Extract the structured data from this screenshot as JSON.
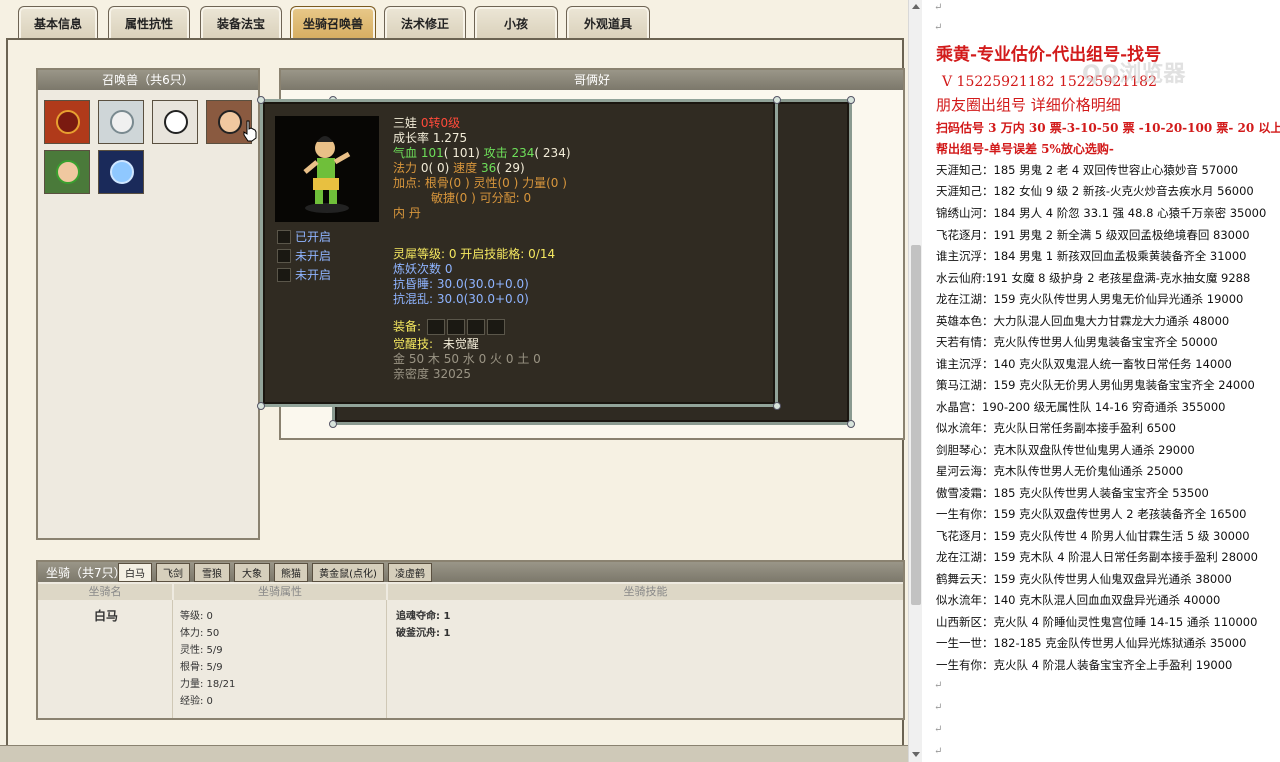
{
  "tabs": [
    {
      "label": "基本信息"
    },
    {
      "label": "属性抗性"
    },
    {
      "label": "装备法宝"
    },
    {
      "label": "坐骑召唤兽"
    },
    {
      "label": "法术修正"
    },
    {
      "label": "小孩"
    },
    {
      "label": "外观道具"
    }
  ],
  "summon_panel": {
    "title": "召唤兽（共6只）"
  },
  "detail_panel": {
    "title": "哥俩好"
  },
  "tooltip": {
    "name": "三娃",
    "rebirth": "0转0级",
    "growth": "成长率 1.275",
    "hp_label": "气血",
    "hp_value": "101",
    "hp_max": "( 101)",
    "atk_label": "攻击",
    "atk_value": "234",
    "atk_max": "( 234)",
    "mp_label": "法力",
    "mp_value": "0",
    "mp_max": "( 0)",
    "spd_label": "速度",
    "spd_value": "36",
    "spd_max": "( 29)",
    "points_line1": "加点:  根骨(0 ) 灵性(0 ) 力量(0 )",
    "points_line2": "敏捷(0 ) 可分配:  0",
    "inner_pill": "内    丹",
    "flags": [
      "已开启",
      "未开启",
      "未开启"
    ],
    "spirit_level": "灵犀等级:  0  开启技能格:  0/14",
    "refine_count": "炼妖次数 0",
    "resist_sleep_label": "抗昏睡:",
    "resist_sleep_value": "30.0(30.0+0.0)",
    "resist_chaos_label": "抗混乱:",
    "resist_chaos_value": "30.0(30.0+0.0)",
    "equip_label": "装备:",
    "awaken_label": "觉醒技:",
    "awaken_value": "未觉醒",
    "elements": "金 50 木 50 水  0 火  0 土  0",
    "intimacy": "亲密度 32025"
  },
  "mount_panel": {
    "title": "坐骑（共7只）",
    "tabs": [
      "白马",
      "飞剑",
      "雪狼",
      "大象",
      "熊猫",
      "黄金鼠(点化)",
      "凌虚鹤"
    ],
    "col_name": "坐骑名",
    "col_attr": "坐骑属性",
    "col_skill": "坐骑技能",
    "mount_name": "白马",
    "stats": [
      "等级:  0",
      "体力:  50",
      "灵性:  5/9",
      "根骨:  5/9",
      "力量:  18/21",
      "经验:  0"
    ],
    "skills": [
      "追魂夺命:  1",
      "破釜沉舟:  1"
    ]
  },
  "doc": {
    "header": "乘黄-专业估价-代出组号-找号",
    "phone": "V 15225921182   15225921182",
    "moments": "朋友圈出组号    详细价格明细",
    "rule1": "扫码估号 3 万内 30 票-3-10-50 票  -10-20-100 票- 20 以上 150",
    "rule2": "帮出组号-单号误差 5%放心选购-",
    "watermark": "QQ浏览器",
    "listings": [
      "天涯知己：185 男鬼 2 老 4 双回传世容止心猿妙音 57000",
      "天涯知己：182 女仙 9 级 2 新孩-火克火炒音去疾水月 56000",
      "锦绣山河：184 男人 4 阶忽 33.1 强 48.8 心猿千万亲密 35000",
      "飞花逐月：191 男鬼 2 新全满 5 级双回孟极绝境春回 83000",
      "谁主沉浮：184 男鬼 1 新孩双回血孟极乘黄装备齐全 31000",
      "水云仙府:191 女魔 8 级护身 2 老孩星盘满-克水抽女魔 9288",
      "龙在江湖：159 克火队传世男人男鬼无价仙异光通杀 19000",
      "英雄本色：大力队混人回血鬼大力甘霖龙大力通杀 48000",
      "天若有情：克火队传世男人仙男鬼装备宝宝齐全 50000",
      "谁主沉浮：140 克火队双鬼混人统一畜牧日常任务 14000",
      "策马江湖：159 克火队无价男人男仙男鬼装备宝宝齐全 24000",
      "水晶宫：190-200 级无属性队 14-16 穷奇通杀 355000",
      "似水流年：克火队日常任务副本接手盈利 6500",
      "剑胆琴心：克木队双盘队传世仙鬼男人通杀 29000",
      "星河云海：克木队传世男人无价鬼仙通杀 25000",
      "傲雪凌霜：185 克火队传世男人装备宝宝齐全 53500",
      "一生有你：159 克火队双盘传世男人 2 老孩装备齐全 16500",
      "飞花逐月：159 克火队传世 4 阶男人仙甘霖生活 5 级 30000",
      "龙在江湖：159 克木队 4 阶混人日常任务副本接手盈利 28000",
      "鹤舞云天：159 克火队传世男人仙鬼双盘异光通杀 38000",
      "似水流年：140 克木队混人回血血双盘异光通杀 40000",
      "山西新区：克火队 4 阶睡仙灵性鬼宫位睡 14-15 通杀 110000",
      "一生一世：182-185 克金队传世男人仙异光炼狱通杀 35000",
      "一生有你：克火队 4 阶混人装备宝宝齐全上手盈利 19000"
    ]
  }
}
